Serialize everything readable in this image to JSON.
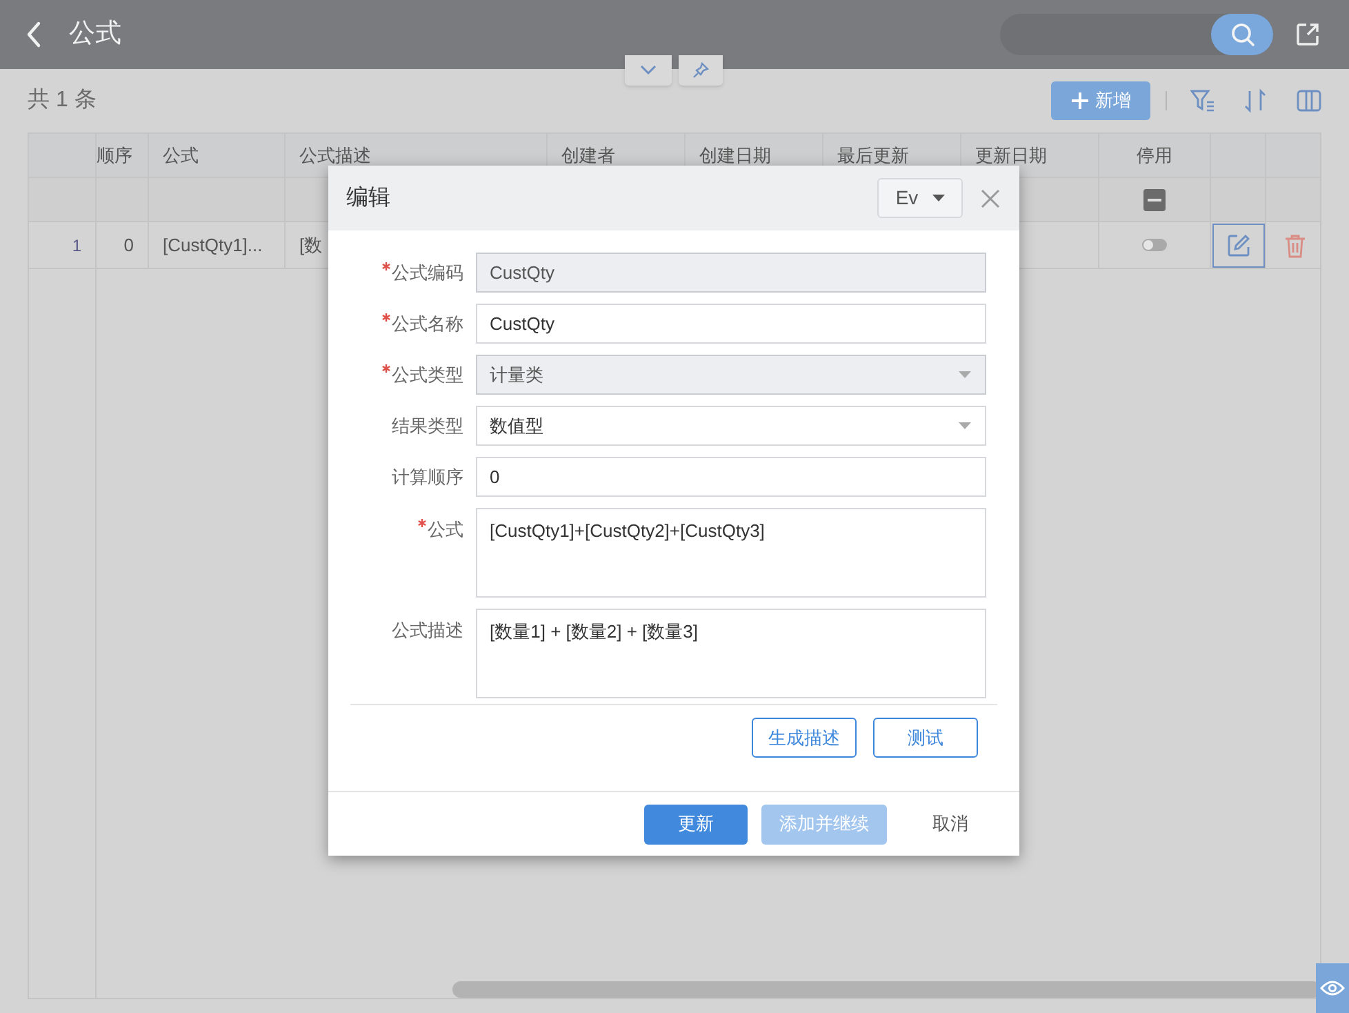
{
  "header": {
    "title": "公式"
  },
  "toolbar": {
    "count": "共 1 条",
    "add_button": "新增"
  },
  "table": {
    "columns": [
      "顺序",
      "公式",
      "公式描述",
      "创建者",
      "创建日期",
      "最后更新",
      "更新日期",
      "停用"
    ],
    "filter_row": {
      "disabled_filter_indeterminate": true
    },
    "rows": [
      {
        "index": "1",
        "order": "0",
        "formula": "[CustQty1]...",
        "description": "[数",
        "disabled": false
      }
    ]
  },
  "dialog": {
    "title": "编辑",
    "language": "Ev",
    "fields": [
      {
        "label": "公式编码",
        "required": true,
        "kind": "text",
        "value": "CustQty",
        "disabled": true
      },
      {
        "label": "公式名称",
        "required": true,
        "kind": "text",
        "value": "CustQty",
        "disabled": false
      },
      {
        "label": "公式类型",
        "required": true,
        "kind": "select",
        "value": "计量类",
        "disabled": true
      },
      {
        "label": "结果类型",
        "required": false,
        "kind": "select",
        "value": "数值型",
        "disabled": false
      },
      {
        "label": "计算顺序",
        "required": false,
        "kind": "text",
        "value": "0",
        "disabled": false
      },
      {
        "label": "公式",
        "required": true,
        "kind": "textarea",
        "value": "[CustQty1]+[CustQty2]+[CustQty3]",
        "disabled": false
      },
      {
        "label": "公式描述",
        "required": false,
        "kind": "textarea",
        "value": "[数量1] + [数量2] + [数量3]",
        "disabled": false
      }
    ],
    "actions": [
      "生成描述",
      "测试"
    ],
    "footer": [
      {
        "label": "更新",
        "kind": "primary",
        "disabled": false
      },
      {
        "label": "添加并继续",
        "kind": "primary",
        "disabled": true
      },
      {
        "label": "取消",
        "kind": "text",
        "disabled": false
      }
    ]
  }
}
